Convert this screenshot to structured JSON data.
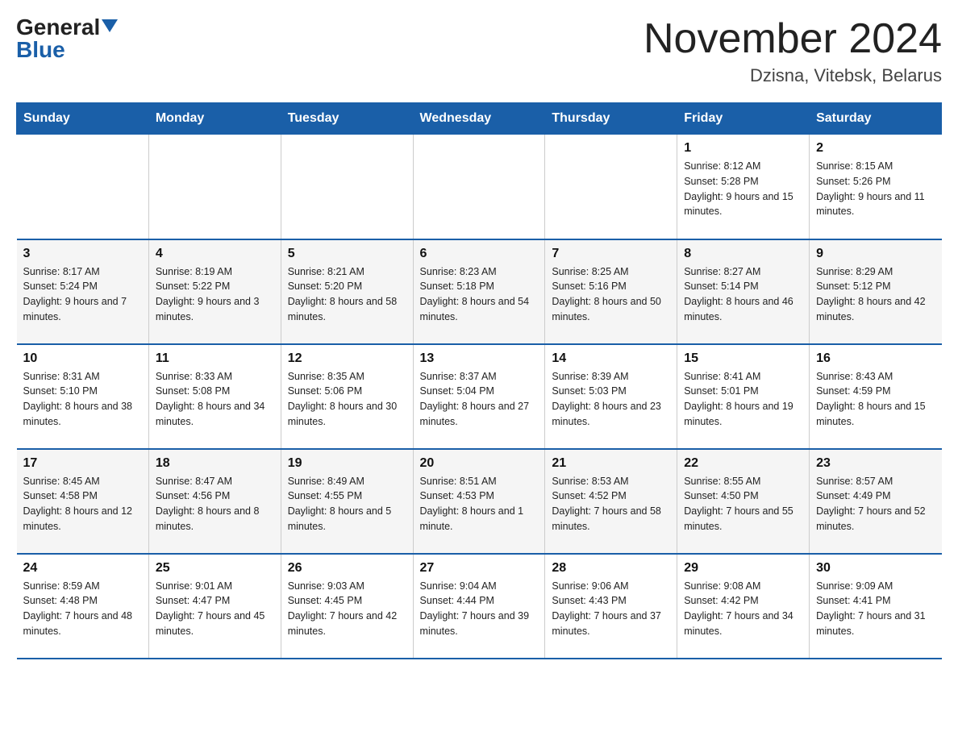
{
  "header": {
    "logo_general": "General",
    "logo_blue": "Blue",
    "month_title": "November 2024",
    "location": "Dzisna, Vitebsk, Belarus"
  },
  "days_of_week": [
    "Sunday",
    "Monday",
    "Tuesday",
    "Wednesday",
    "Thursday",
    "Friday",
    "Saturday"
  ],
  "weeks": [
    [
      {
        "day": "",
        "info": ""
      },
      {
        "day": "",
        "info": ""
      },
      {
        "day": "",
        "info": ""
      },
      {
        "day": "",
        "info": ""
      },
      {
        "day": "",
        "info": ""
      },
      {
        "day": "1",
        "info": "Sunrise: 8:12 AM\nSunset: 5:28 PM\nDaylight: 9 hours and 15 minutes."
      },
      {
        "day": "2",
        "info": "Sunrise: 8:15 AM\nSunset: 5:26 PM\nDaylight: 9 hours and 11 minutes."
      }
    ],
    [
      {
        "day": "3",
        "info": "Sunrise: 8:17 AM\nSunset: 5:24 PM\nDaylight: 9 hours and 7 minutes."
      },
      {
        "day": "4",
        "info": "Sunrise: 8:19 AM\nSunset: 5:22 PM\nDaylight: 9 hours and 3 minutes."
      },
      {
        "day": "5",
        "info": "Sunrise: 8:21 AM\nSunset: 5:20 PM\nDaylight: 8 hours and 58 minutes."
      },
      {
        "day": "6",
        "info": "Sunrise: 8:23 AM\nSunset: 5:18 PM\nDaylight: 8 hours and 54 minutes."
      },
      {
        "day": "7",
        "info": "Sunrise: 8:25 AM\nSunset: 5:16 PM\nDaylight: 8 hours and 50 minutes."
      },
      {
        "day": "8",
        "info": "Sunrise: 8:27 AM\nSunset: 5:14 PM\nDaylight: 8 hours and 46 minutes."
      },
      {
        "day": "9",
        "info": "Sunrise: 8:29 AM\nSunset: 5:12 PM\nDaylight: 8 hours and 42 minutes."
      }
    ],
    [
      {
        "day": "10",
        "info": "Sunrise: 8:31 AM\nSunset: 5:10 PM\nDaylight: 8 hours and 38 minutes."
      },
      {
        "day": "11",
        "info": "Sunrise: 8:33 AM\nSunset: 5:08 PM\nDaylight: 8 hours and 34 minutes."
      },
      {
        "day": "12",
        "info": "Sunrise: 8:35 AM\nSunset: 5:06 PM\nDaylight: 8 hours and 30 minutes."
      },
      {
        "day": "13",
        "info": "Sunrise: 8:37 AM\nSunset: 5:04 PM\nDaylight: 8 hours and 27 minutes."
      },
      {
        "day": "14",
        "info": "Sunrise: 8:39 AM\nSunset: 5:03 PM\nDaylight: 8 hours and 23 minutes."
      },
      {
        "day": "15",
        "info": "Sunrise: 8:41 AM\nSunset: 5:01 PM\nDaylight: 8 hours and 19 minutes."
      },
      {
        "day": "16",
        "info": "Sunrise: 8:43 AM\nSunset: 4:59 PM\nDaylight: 8 hours and 15 minutes."
      }
    ],
    [
      {
        "day": "17",
        "info": "Sunrise: 8:45 AM\nSunset: 4:58 PM\nDaylight: 8 hours and 12 minutes."
      },
      {
        "day": "18",
        "info": "Sunrise: 8:47 AM\nSunset: 4:56 PM\nDaylight: 8 hours and 8 minutes."
      },
      {
        "day": "19",
        "info": "Sunrise: 8:49 AM\nSunset: 4:55 PM\nDaylight: 8 hours and 5 minutes."
      },
      {
        "day": "20",
        "info": "Sunrise: 8:51 AM\nSunset: 4:53 PM\nDaylight: 8 hours and 1 minute."
      },
      {
        "day": "21",
        "info": "Sunrise: 8:53 AM\nSunset: 4:52 PM\nDaylight: 7 hours and 58 minutes."
      },
      {
        "day": "22",
        "info": "Sunrise: 8:55 AM\nSunset: 4:50 PM\nDaylight: 7 hours and 55 minutes."
      },
      {
        "day": "23",
        "info": "Sunrise: 8:57 AM\nSunset: 4:49 PM\nDaylight: 7 hours and 52 minutes."
      }
    ],
    [
      {
        "day": "24",
        "info": "Sunrise: 8:59 AM\nSunset: 4:48 PM\nDaylight: 7 hours and 48 minutes."
      },
      {
        "day": "25",
        "info": "Sunrise: 9:01 AM\nSunset: 4:47 PM\nDaylight: 7 hours and 45 minutes."
      },
      {
        "day": "26",
        "info": "Sunrise: 9:03 AM\nSunset: 4:45 PM\nDaylight: 7 hours and 42 minutes."
      },
      {
        "day": "27",
        "info": "Sunrise: 9:04 AM\nSunset: 4:44 PM\nDaylight: 7 hours and 39 minutes."
      },
      {
        "day": "28",
        "info": "Sunrise: 9:06 AM\nSunset: 4:43 PM\nDaylight: 7 hours and 37 minutes."
      },
      {
        "day": "29",
        "info": "Sunrise: 9:08 AM\nSunset: 4:42 PM\nDaylight: 7 hours and 34 minutes."
      },
      {
        "day": "30",
        "info": "Sunrise: 9:09 AM\nSunset: 4:41 PM\nDaylight: 7 hours and 31 minutes."
      }
    ]
  ]
}
